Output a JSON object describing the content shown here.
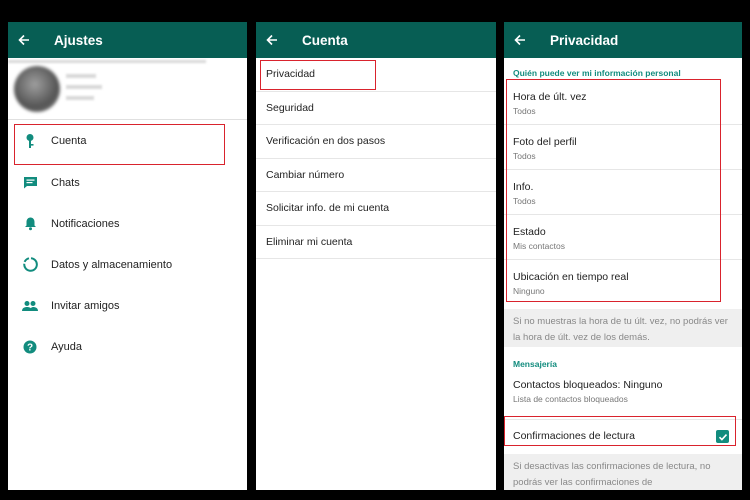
{
  "settings": {
    "title": "Ajustes",
    "items": [
      {
        "label": "Cuenta",
        "icon": "key-icon"
      },
      {
        "label": "Chats",
        "icon": "chat-icon"
      },
      {
        "label": "Notificaciones",
        "icon": "bell-icon"
      },
      {
        "label": "Datos y almacenamiento",
        "icon": "data-usage-icon"
      },
      {
        "label": "Invitar amigos",
        "icon": "people-icon"
      },
      {
        "label": "Ayuda",
        "icon": "help-icon"
      }
    ]
  },
  "account": {
    "title": "Cuenta",
    "items": [
      {
        "label": "Privacidad"
      },
      {
        "label": "Seguridad"
      },
      {
        "label": "Verificación en dos pasos"
      },
      {
        "label": "Cambiar número"
      },
      {
        "label": "Solicitar info. de mi cuenta"
      },
      {
        "label": "Eliminar mi cuenta"
      }
    ]
  },
  "privacy": {
    "title": "Privacidad",
    "section_who": "Quién puede ver mi información personal",
    "items": [
      {
        "title": "Hora de últ. vez",
        "value": "Todos"
      },
      {
        "title": "Foto del perfil",
        "value": "Todos"
      },
      {
        "title": "Info.",
        "value": "Todos"
      },
      {
        "title": "Estado",
        "value": "Mis contactos"
      },
      {
        "title": "Ubicación en tiempo real",
        "value": "Ninguno"
      }
    ],
    "note_last_seen": "Si no muestras la hora de tu últ. vez, no podrás ver la hora de últ. vez de los demás.",
    "section_messaging": "Mensajería",
    "blocked_title": "Contactos bloqueados: Ninguno",
    "blocked_sub": "Lista de contactos bloqueados",
    "read_receipts_label": "Confirmaciones de lectura",
    "read_receipts_checked": true,
    "note_read_receipts": "Si desactivas las confirmaciones de lectura, no podrás ver las confirmaciones de"
  },
  "colors": {
    "appbar": "#075e54",
    "accent": "#128c7e",
    "highlight": "#d9232d"
  }
}
